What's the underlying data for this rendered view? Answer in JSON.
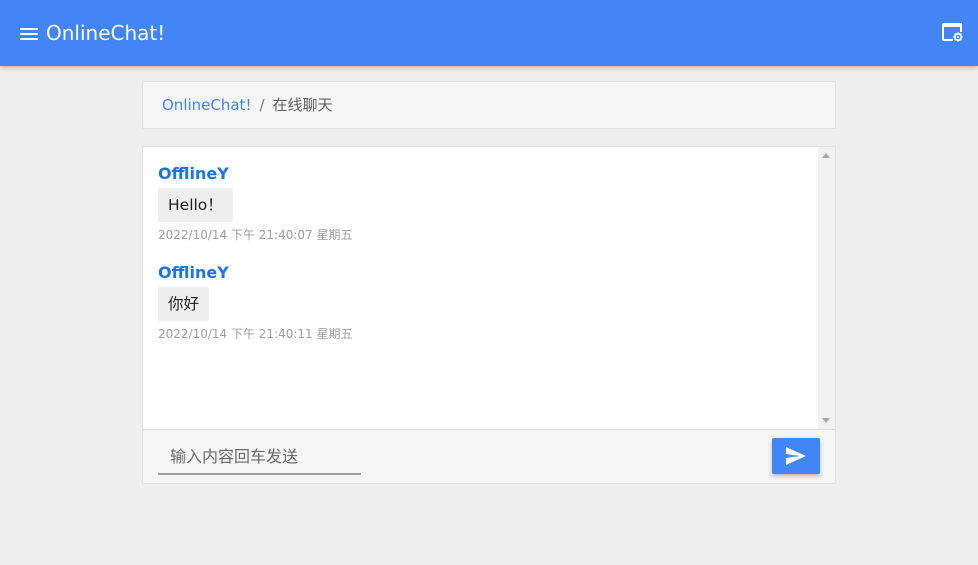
{
  "appbar": {
    "title": "OnlineChat!",
    "menu_icon": "menu-icon",
    "settings_icon": "window-settings-icon",
    "color": "#4285f4"
  },
  "breadcrumb": {
    "home": "OnlineChat!",
    "separator": "/",
    "current": "在线聊天"
  },
  "messages": [
    {
      "sender": "OfflineY",
      "text": "Hello！",
      "time": "2022/10/14 下午 21:40:07 星期五"
    },
    {
      "sender": "OfflineY",
      "text": "你好",
      "time": "2022/10/14 下午 21:40:11 星期五"
    }
  ],
  "composer": {
    "placeholder": "输入内容回车发送",
    "value": "",
    "send_icon": "send-icon"
  }
}
